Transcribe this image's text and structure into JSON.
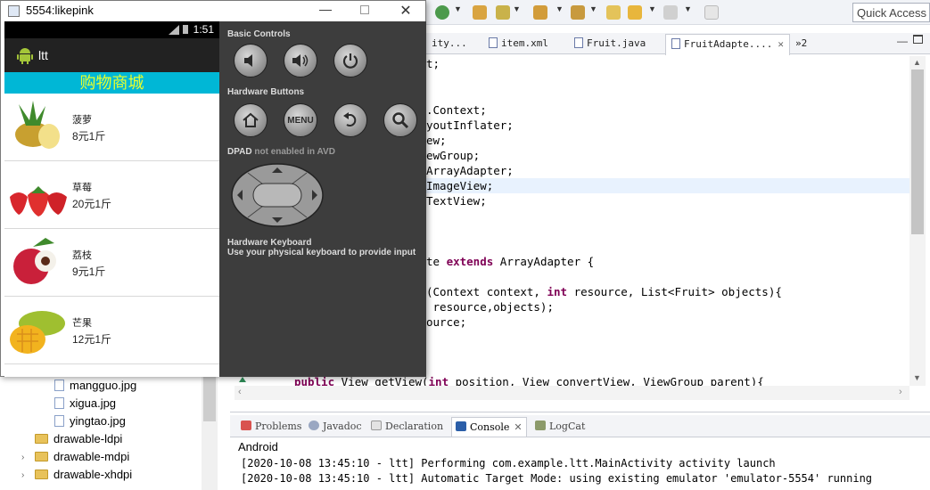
{
  "emulator": {
    "window_title": "5554:likepink",
    "status_time": "1:51",
    "app_name": "ltt",
    "shop_title": "购物商城",
    "fruits": [
      {
        "name": "菠萝",
        "price": "8元1斤"
      },
      {
        "name": "草莓",
        "price": "20元1斤"
      },
      {
        "name": "荔枝",
        "price": "9元1斤"
      },
      {
        "name": "芒果",
        "price": "12元1斤"
      }
    ],
    "controls": {
      "basic_label": "Basic Controls",
      "hardware_label": "Hardware Buttons",
      "menu_label": "MENU",
      "dpad_label": "DPAD",
      "dpad_note": "not enabled in AVD",
      "keyboard_label": "Hardware Keyboard",
      "keyboard_note": "Use your physical keyboard to provide input"
    }
  },
  "toolbar": {
    "quick_access_placeholder": "Quick Access"
  },
  "editor": {
    "tabs": [
      {
        "label": "ity..."
      },
      {
        "label": "item.xml"
      },
      {
        "label": "Fruit.java"
      },
      {
        "label": "FruitAdapte....",
        "active": true
      },
      {
        "label": "»2"
      }
    ],
    "lines": [
      {
        "text": "t;"
      },
      {
        "text": ".Context;"
      },
      {
        "text": "youtInflater;"
      },
      {
        "text": "ew;"
      },
      {
        "text": "ewGroup;"
      },
      {
        "text": "ArrayAdapter;"
      },
      {
        "text": "ImageView;"
      },
      {
        "text": "TextView;"
      },
      {
        "pre": "te ",
        "kw": "extends",
        "post": " ArrayAdapter {"
      },
      {
        "pre": "(Context context, ",
        "kw": "int",
        "post": " resource, List<Fruit> objects){"
      },
      {
        "text": " resource,objects);"
      },
      {
        "text": "ource;"
      }
    ],
    "last_line": {
      "kw1": "public",
      "mid1": " View getView(",
      "kw2": "int",
      "post": " position, View convertView, ViewGroup parent){"
    }
  },
  "console": {
    "tabs": [
      "Problems",
      "Javadoc",
      "Declaration",
      "Console",
      "LogCat"
    ],
    "active_tab": "Console",
    "device": "Android",
    "lines": [
      "[2020-10-08 13:45:10 - ltt] Performing com.example.ltt.MainActivity activity launch",
      "[2020-10-08 13:45:10 - ltt] Automatic Target Mode: using existing emulator 'emulator-5554' running"
    ]
  },
  "tree": {
    "items": [
      {
        "label": "mangguo.jpg",
        "type": "file"
      },
      {
        "label": "xigua.jpg",
        "type": "file"
      },
      {
        "label": "yingtao.jpg",
        "type": "file"
      },
      {
        "label": "drawable-ldpi",
        "type": "folder"
      },
      {
        "label": "drawable-mdpi",
        "type": "folder"
      },
      {
        "label": "drawable-xhdpi",
        "type": "folder"
      }
    ]
  },
  "colors": {
    "shop_header_bg": "#00b7d6",
    "shop_header_text": "#e8ff2e",
    "keyword": "#7f0055"
  }
}
